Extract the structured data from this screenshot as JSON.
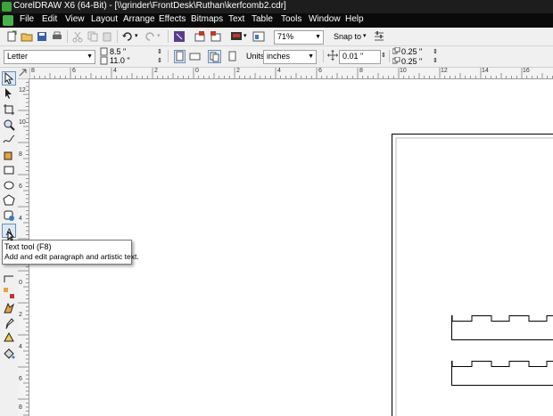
{
  "window": {
    "title": "CorelDRAW X6 (64-Bit) - [\\\\grinder\\FrontDesk\\Ruthan\\kerfcomb2.cdr]"
  },
  "menu": [
    {
      "label": "File"
    },
    {
      "label": "Edit"
    },
    {
      "label": "View"
    },
    {
      "label": "Layout"
    },
    {
      "label": "Arrange"
    },
    {
      "label": "Effects"
    },
    {
      "label": "Bitmaps"
    },
    {
      "label": "Text"
    },
    {
      "label": "Table"
    },
    {
      "label": "Tools"
    },
    {
      "label": "Window"
    },
    {
      "label": "Help"
    }
  ],
  "standard_toolbar": {
    "zoom_value": "71%",
    "snap_to_label": "Snap to"
  },
  "property_bar": {
    "page_size": "Letter",
    "width": "8.5 \"",
    "height": "11.0 \"",
    "units_label": "Units:",
    "units_value": "inches",
    "nudge": "0.01 \"",
    "dup_x": "0.25 \"",
    "dup_y": "0.25 \""
  },
  "ruler": {
    "h_ticks": [
      "8",
      "6",
      "4",
      "2",
      "0",
      "2",
      "4",
      "6",
      "8",
      "10",
      "12",
      "14",
      "16"
    ],
    "v_ticks": [
      "12",
      "10",
      "8",
      "6",
      "4",
      "2",
      "0",
      "2",
      "4",
      "6",
      "8"
    ]
  },
  "tooltip": {
    "title": "Text tool (F8)",
    "description": "Add and edit paragraph and artistic text."
  },
  "colors": {
    "menubar": "#0a0a0a",
    "chrome": "#f0f0f0",
    "accent": "#47b24a"
  }
}
